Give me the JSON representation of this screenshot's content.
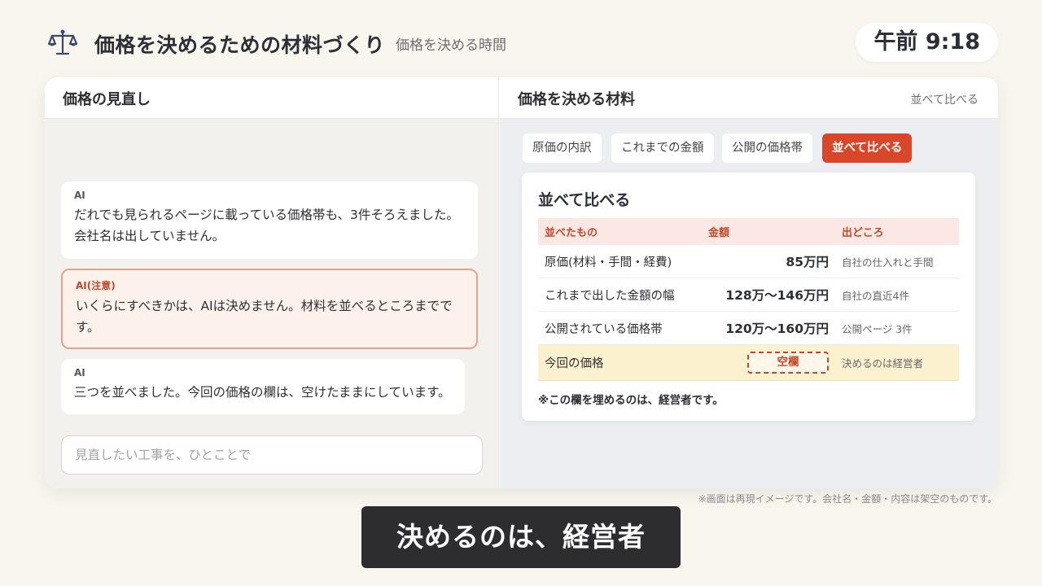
{
  "header": {
    "icon": "scale-icon",
    "title": "価格を決めるための材料づくり",
    "subtitle": "価格を決める時間",
    "clock": "午前 9:18"
  },
  "left_pane": {
    "title": "価格の見直し",
    "messages": [
      {
        "role": "AI",
        "text": "だれでも見られるページに載っている価格帯も、3件そろえました。会社名は出していません。",
        "type": "normal"
      },
      {
        "role": "AI(注意)",
        "text": "いくらにすべきかは、AIは決めません。材料を並べるところまでです。",
        "type": "warning"
      },
      {
        "role": "AI",
        "text": "三つを並べました。今回の価格の欄は、空けたままにしています。",
        "type": "normal"
      }
    ],
    "input_placeholder": "見直したい工事を、ひとことで"
  },
  "right_pane": {
    "title": "価格を決める材料",
    "link": "並べて比べる",
    "tabs": [
      {
        "label": "原価の内訳",
        "active": false
      },
      {
        "label": "これまでの金額",
        "active": false
      },
      {
        "label": "公開の価格帯",
        "active": false
      },
      {
        "label": "並べて比べる",
        "active": true
      }
    ],
    "compare": {
      "title": "並べて比べる",
      "headers": [
        "並べたもの",
        "金額",
        "出どころ"
      ],
      "rows": [
        {
          "item": "原価(材料・手間・経費)",
          "amount": "85万円",
          "source": "自社の仕入れと手間"
        },
        {
          "item": "これまで出した金額の幅",
          "amount": "128万〜146万円",
          "source": "自社の直近4件"
        },
        {
          "item": "公開されている価格帯",
          "amount": "120万〜160万円",
          "source": "公開ページ 3件"
        },
        {
          "item": "今回の価格",
          "amount": "空欄",
          "source": "決めるのは経営者"
        }
      ],
      "note": "※この欄を埋めるのは、経営者です。"
    }
  },
  "footer": {
    "disclaimer": "※画面は再現イメージです。会社名・金額・内容は架空のものです。",
    "caption": "決めるのは、経営者"
  },
  "colors": {
    "accent": "#d9472a",
    "warning_border": "#e2a48e",
    "highlight_row": "#fcf1cf",
    "background": "#f9f5ef"
  }
}
